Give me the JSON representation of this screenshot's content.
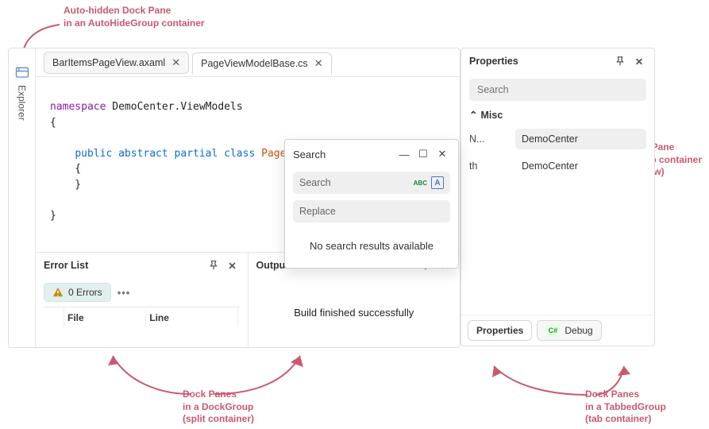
{
  "annotations": {
    "autohide": "Auto-hidden Dock Pane\nin an AutoHideGroup container",
    "floating": "Floating Dock Pane\nin a FloatGroup container\n(floating window)",
    "dockgroup": "Dock Panes\nin a DockGroup\n(split container)",
    "tabbedgroup": "Dock Panes\nin a TabbedGroup\n(tab container)"
  },
  "autohide": {
    "label": "Explorer"
  },
  "tabs": [
    {
      "label": "BarItemsPageView.axaml",
      "active": false
    },
    {
      "label": "PageViewModelBase.cs",
      "active": true
    }
  ],
  "code": {
    "ns_kw": "namespace",
    "ns_name": "DemoCenter.ViewModels",
    "mods": "public abstract partial class",
    "class_name": "PageViewMode"
  },
  "error_list": {
    "title": "Error List",
    "pill": "0 Errors",
    "cols": [
      "",
      "File",
      "Line"
    ]
  },
  "output": {
    "title": "Output",
    "body": "Build finished successfully"
  },
  "properties": {
    "title": "Properties",
    "search_placeholder": "Search",
    "group": "Misc",
    "rows": [
      {
        "label": "N...",
        "value": "DemoCenter",
        "boxed": true
      },
      {
        "label": "th",
        "value": "DemoCenter",
        "boxed": false
      }
    ],
    "tabs": {
      "properties": "Properties",
      "debug": "Debug"
    }
  },
  "search_window": {
    "title": "Search",
    "search_placeholder": "Search",
    "replace_placeholder": "Replace",
    "abc": "ABC",
    "a": "A",
    "no_results": "No search results available"
  }
}
